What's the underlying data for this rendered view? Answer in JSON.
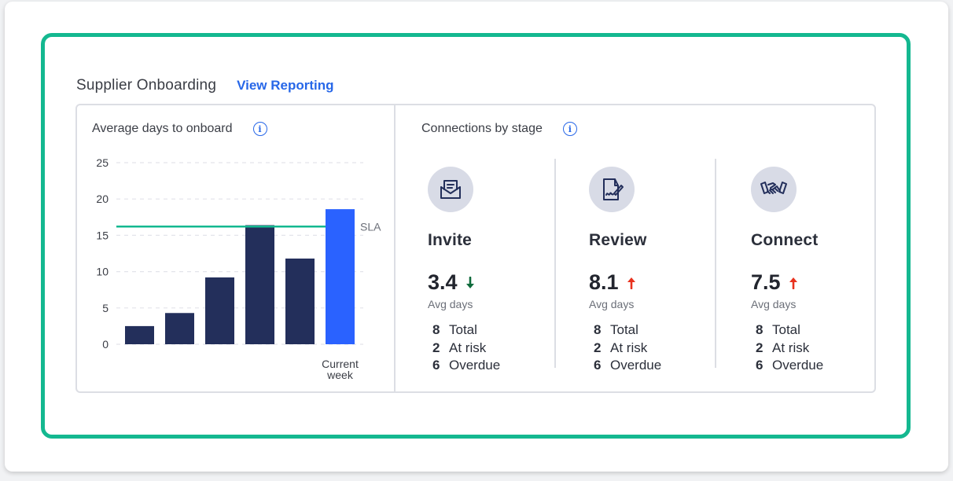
{
  "widget": {
    "title": "Supplier Onboarding",
    "view_link": "View Reporting"
  },
  "avg_days_section": {
    "title": "Average days to onboard",
    "info_icon": "info-icon"
  },
  "chart_data": {
    "type": "bar",
    "title": "Average days to onboard",
    "categories": [
      "",
      "",
      "",
      "",
      "",
      "Current week"
    ],
    "values": [
      2.5,
      4.3,
      9.2,
      16.4,
      11.8,
      18.6
    ],
    "ylim": [
      0,
      25
    ],
    "yticks": [
      0,
      5,
      10,
      15,
      20,
      25
    ],
    "reference_line": {
      "label": "SLA",
      "value": 16.2
    },
    "grid": "horizontal dashed",
    "colors": {
      "bars": "#232f5b",
      "highlight": "#2a62ff",
      "sla": "#14b890"
    },
    "highlight_index": 5
  },
  "connections_section": {
    "title": "Connections by stage",
    "info_icon": "info-icon"
  },
  "stages": [
    {
      "name": "Invite",
      "icon": "envelope-icon",
      "value": "3.4",
      "trend": "down",
      "trend_color": "#0f6b3c",
      "sub": "Avg days",
      "stats": [
        {
          "num": "8",
          "label": "Total"
        },
        {
          "num": "2",
          "label": "At risk"
        },
        {
          "num": "6",
          "label": "Overdue"
        }
      ]
    },
    {
      "name": "Review",
      "icon": "document-sign-icon",
      "value": "8.1",
      "trend": "up",
      "trend_color": "#e8321e",
      "sub": "Avg days",
      "stats": [
        {
          "num": "8",
          "label": "Total"
        },
        {
          "num": "2",
          "label": "At risk"
        },
        {
          "num": "6",
          "label": "Overdue"
        }
      ]
    },
    {
      "name": "Connect",
      "icon": "handshake-icon",
      "value": "7.5",
      "trend": "up",
      "trend_color": "#e8321e",
      "sub": "Avg days",
      "stats": [
        {
          "num": "8",
          "label": "Total"
        },
        {
          "num": "2",
          "label": "At risk"
        },
        {
          "num": "6",
          "label": "Overdue"
        }
      ]
    }
  ],
  "colors": {
    "accent_frame": "#14b890",
    "link": "#2767e8",
    "icon_bg": "#d8dbe6",
    "icon_stroke": "#232f5b"
  }
}
